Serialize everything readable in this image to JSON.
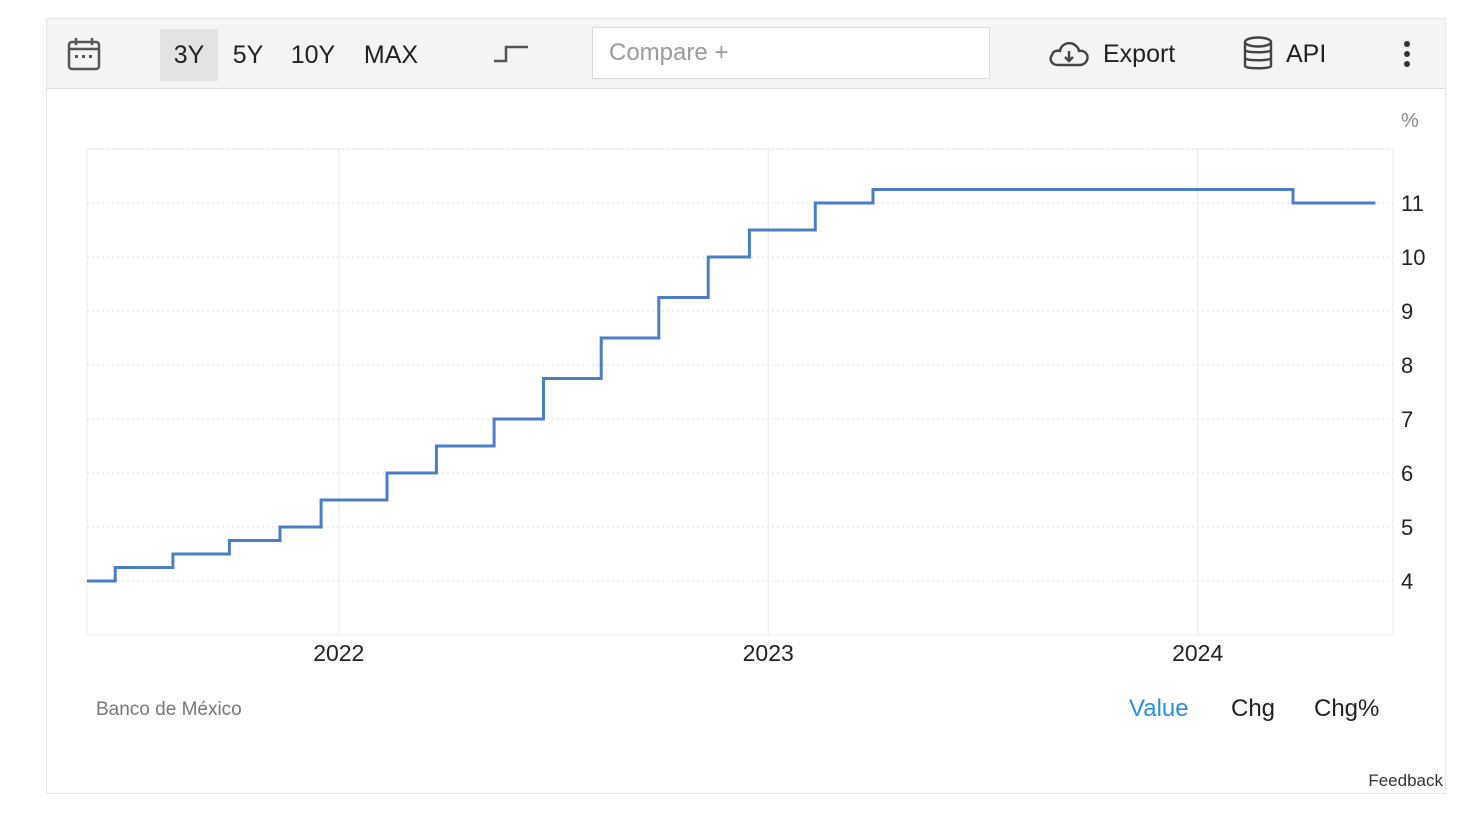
{
  "toolbar": {
    "icons": {
      "calendar": "calendar-icon",
      "chart_type": "step-line-icon",
      "export": "cloud-download-icon",
      "api": "database-icon",
      "more": "more-vertical-icon"
    },
    "ranges": [
      "3Y",
      "5Y",
      "10Y",
      "MAX"
    ],
    "active_range": "3Y",
    "compare_placeholder": "Compare +",
    "export_label": "Export",
    "api_label": "API"
  },
  "footer": {
    "source": "Banco de México",
    "modes": [
      "Value",
      "Chg",
      "Chg%"
    ],
    "active_mode": "Value",
    "feedback": "Feedback"
  },
  "colors": {
    "line": "#4a7ec8",
    "active_mode": "#2a8fe0",
    "grid": "#dcdcdc"
  },
  "chart_data": {
    "type": "line",
    "step": true,
    "title": "",
    "xlabel": "",
    "ylabel": "%",
    "x_ticks": [
      "2022",
      "2023",
      "2024"
    ],
    "y_ticks": [
      4,
      5,
      6,
      7,
      8,
      9,
      10,
      11
    ],
    "xlim": [
      "2021-06-01",
      "2024-06-15"
    ],
    "ylim": [
      3,
      12
    ],
    "grid": true,
    "series": [
      {
        "x": [
          "2021-06-01",
          "2021-06-25",
          "2021-08-13",
          "2021-09-30",
          "2021-11-12",
          "2021-12-17",
          "2022-02-11",
          "2022-03-25",
          "2022-05-13",
          "2022-06-24",
          "2022-08-12",
          "2022-09-30",
          "2022-11-11",
          "2022-12-16",
          "2023-02-10",
          "2023-03-31",
          "2024-03-22",
          "2024-05-31"
        ],
        "y": [
          4.0,
          4.25,
          4.5,
          4.75,
          5.0,
          5.5,
          6.0,
          6.5,
          7.0,
          7.75,
          8.5,
          9.25,
          10.0,
          10.5,
          11.0,
          11.25,
          11.0,
          11.0
        ]
      }
    ]
  }
}
